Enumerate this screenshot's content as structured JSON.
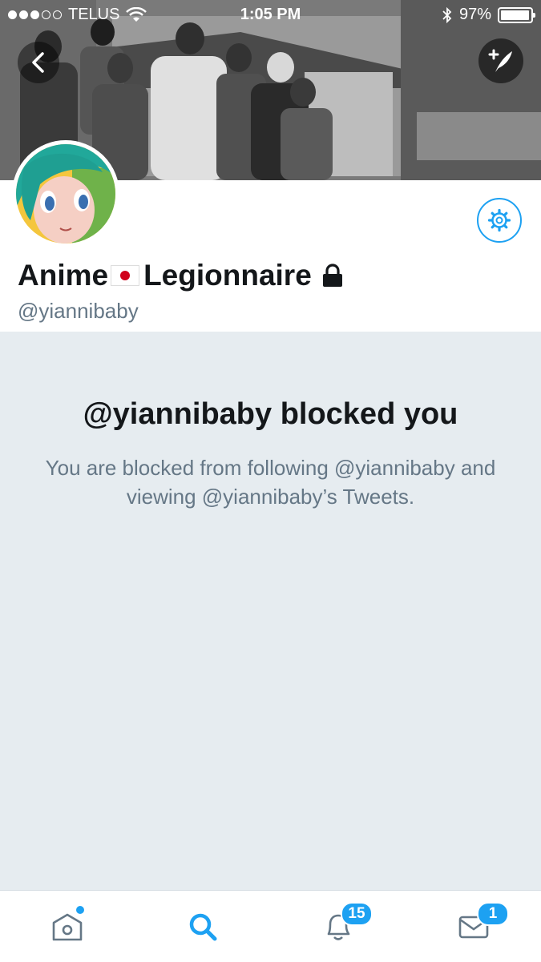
{
  "status": {
    "carrier": "TELUS",
    "time": "1:05 PM",
    "battery": "97%",
    "battery_level": 0.97
  },
  "header": {
    "back_icon": "chevron-left-icon",
    "compose_icon": "compose-tweet-icon"
  },
  "profile": {
    "name_part1": "Anime",
    "flag": "japan-flag",
    "name_part2": "Legionnaire",
    "handle": "@yiannibaby",
    "protected_icon": "lock-icon",
    "settings_icon": "gear-icon"
  },
  "blocked": {
    "title": "@yiannibaby blocked you",
    "message": "You are blocked from following @yiannibaby and viewing @yiannibaby’s Tweets."
  },
  "tabbar": {
    "home_icon": "home-icon",
    "search_icon": "search-icon",
    "notifications_icon": "bell-icon",
    "notifications_count": "15",
    "messages_icon": "envelope-icon",
    "messages_count": "1"
  },
  "colors": {
    "accent": "#1da1f2",
    "background": "#e6ecf0",
    "text": "#14171a",
    "muted": "#657786"
  }
}
